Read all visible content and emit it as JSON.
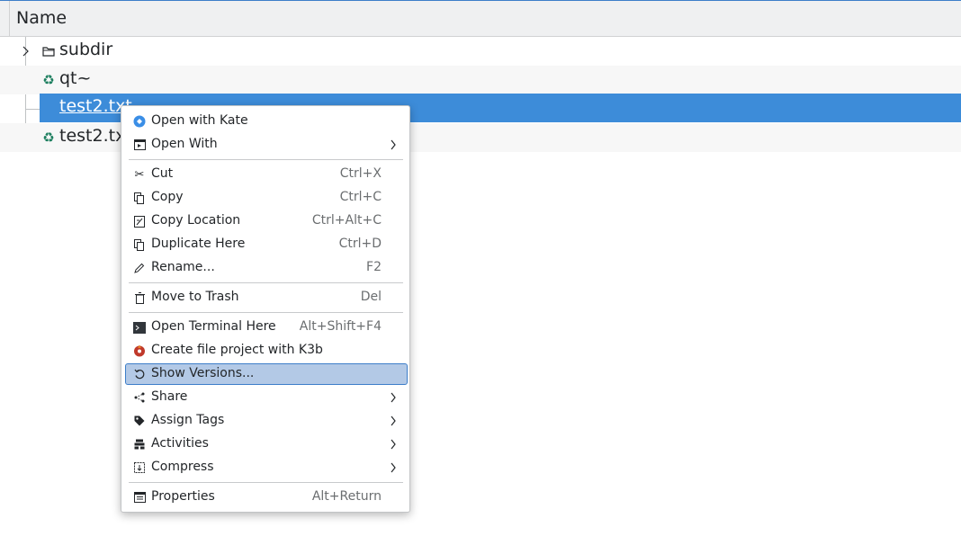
{
  "header": {
    "title": "Name"
  },
  "files": [
    {
      "name": "subdir",
      "icon": "folder-icon"
    },
    {
      "name": "qt~",
      "icon": "recycle-icon"
    },
    {
      "name": "test2.txt",
      "icon": "file-icon",
      "selected": true
    },
    {
      "name": "test2.txt",
      "icon": "recycle-icon"
    }
  ],
  "menu": {
    "items": [
      {
        "label": "Open with Kate",
        "shortcut": "",
        "icon": "kate-icon"
      },
      {
        "label": "Open With",
        "shortcut": "",
        "icon": "open-with-icon",
        "submenu": true
      },
      {
        "label": "Cut",
        "shortcut": "Ctrl+X",
        "icon": "scissors-icon"
      },
      {
        "label": "Copy",
        "shortcut": "Ctrl+C",
        "icon": "copy-icon"
      },
      {
        "label": "Copy Location",
        "shortcut": "Ctrl+Alt+C",
        "icon": "copy-location-icon"
      },
      {
        "label": "Duplicate Here",
        "shortcut": "Ctrl+D",
        "icon": "duplicate-icon"
      },
      {
        "label": "Rename...",
        "shortcut": "F2",
        "icon": "pencil-icon"
      },
      {
        "label": "Move to Trash",
        "shortcut": "Del",
        "icon": "trash-icon"
      },
      {
        "label": "Open Terminal Here",
        "shortcut": "Alt+Shift+F4",
        "icon": "terminal-icon"
      },
      {
        "label": "Create file project with K3b",
        "shortcut": "",
        "icon": "k3b-icon"
      },
      {
        "label": "Show Versions...",
        "shortcut": "",
        "icon": "history-icon",
        "highlighted": true
      },
      {
        "label": "Share",
        "shortcut": "",
        "icon": "share-icon",
        "submenu": true
      },
      {
        "label": "Assign Tags",
        "shortcut": "",
        "icon": "tag-icon",
        "submenu": true
      },
      {
        "label": "Activities",
        "shortcut": "",
        "icon": "activities-icon",
        "submenu": true
      },
      {
        "label": "Compress",
        "shortcut": "",
        "icon": "compress-icon",
        "submenu": true
      },
      {
        "label": "Properties",
        "shortcut": "Alt+Return",
        "icon": "properties-icon"
      }
    ]
  },
  "colors": {
    "selection": "#3d8cd9",
    "menu_highlight": "#b3c9e6",
    "accent": "#3d7ec9",
    "recycle": "#1d7f5f"
  }
}
